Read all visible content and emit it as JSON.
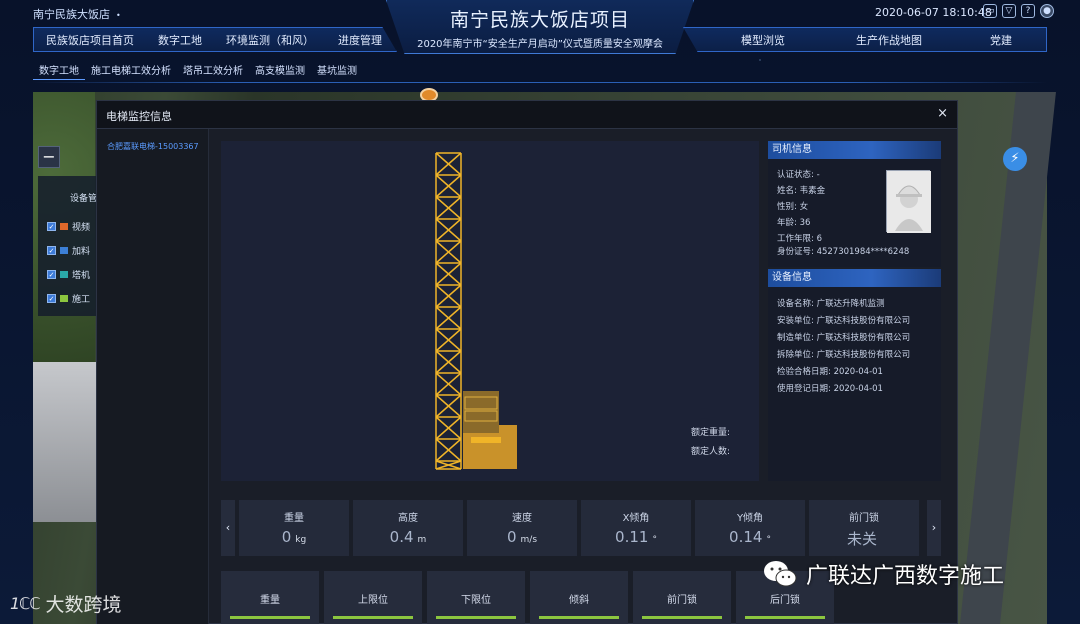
{
  "header": {
    "project_switch": "南宁民族大饭店",
    "project_switch_dot": "•",
    "title": "南宁民族大饭店项目",
    "subtitle": "2020年南宁市“安全生产月启动”仪式暨质量安全观摩会",
    "datetime": "2020-06-07 18:10:48",
    "icons": [
      "monitor-icon",
      "shirt-icon",
      "help-icon",
      "user-avatar-icon"
    ]
  },
  "nav_left": [
    "民族饭店项目首页",
    "数字工地",
    "环境监测（和风）",
    "进度管理"
  ],
  "nav_right": [
    "模型浏览",
    "生产作战地图",
    "党建"
  ],
  "subnav": [
    "数字工地",
    "施工电梯工效分析",
    "塔吊工效分析",
    "高支模监测",
    "基坑监测"
  ],
  "subnav_active": 0,
  "map": {
    "minus": "−",
    "layer_panel_title": "设备管",
    "layers": [
      {
        "label": "视频",
        "icon_color": "#e0682a"
      },
      {
        "label": "加料",
        "icon_color": "#3c7fd6"
      },
      {
        "label": "塔机",
        "icon_color": "#2aa8a8"
      },
      {
        "label": "施工",
        "icon_color": "#8cc63f"
      }
    ],
    "bolt": "⚡"
  },
  "modal": {
    "title": "电梯监控信息",
    "close": "×",
    "elevator_link": "合肥嘉联电梯-15003367",
    "rated_load_label": "额定重量:",
    "rated_persons_label": "额定人数:"
  },
  "driver": {
    "header": "司机信息",
    "rows": [
      "认证状态: -",
      "姓名: 韦素金",
      "性别: 女",
      "年龄: 36",
      "工作年限: 6",
      "身份证号: 4527301984****6248"
    ]
  },
  "device": {
    "header": "设备信息",
    "rows": [
      "设备名称: 广联达升降机监测",
      "安装单位: 广联达科技股份有限公司",
      "制造单位: 广联达科技股份有限公司",
      "拆除单位: 广联达科技股份有限公司",
      "检验合格日期: 2020-04-01",
      "使用登记日期: 2020-04-01"
    ]
  },
  "stats": [
    {
      "label": "重量",
      "value": "0",
      "unit": "kg"
    },
    {
      "label": "高度",
      "value": "0.4",
      "unit": "m"
    },
    {
      "label": "速度",
      "value": "0",
      "unit": "m/s"
    },
    {
      "label": "X倾角",
      "value": "0.11",
      "unit": "°"
    },
    {
      "label": "Y倾角",
      "value": "0.14",
      "unit": "°"
    },
    {
      "label": "前门锁",
      "value": "未关",
      "unit": ""
    }
  ],
  "stat_prev": "‹",
  "stat_next": "›",
  "status_tabs": [
    "重量",
    "上限位",
    "下限位",
    "倾斜",
    "前门锁",
    "后门锁"
  ],
  "watermark_right": "广联达广西数字施工",
  "watermark_left_logo": "1ℂℂ",
  "watermark_left_text": "大数跨境",
  "colors": {
    "tower": "#f0b428",
    "cab": "#c9922a",
    "accent": "#2f66c8",
    "status_bar": "#8cc63f"
  }
}
